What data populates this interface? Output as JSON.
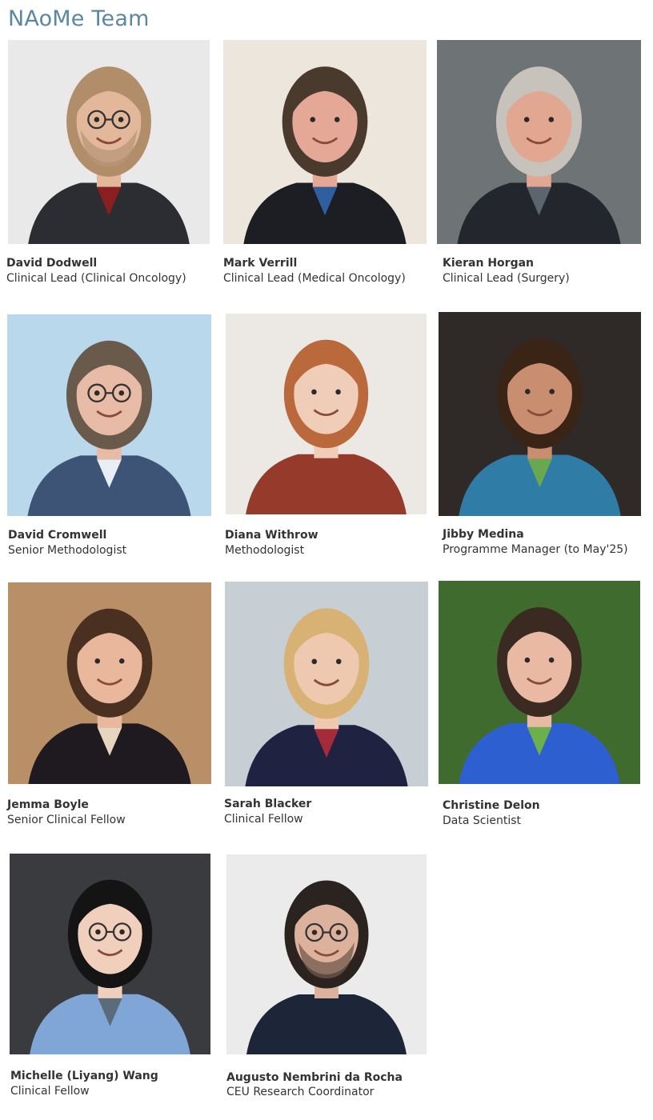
{
  "page": {
    "title": "NAoMe Team"
  },
  "members": [
    {
      "name": "David Dodwell",
      "role": "Clinical Lead (Clinical Oncology)",
      "photo": {
        "bg": "#e9e9e9",
        "skin": "#e2b79a",
        "hair": "#b28d6a",
        "top": "#2b2d33",
        "glasses": true,
        "beard": "#b89677",
        "accent": "#8b1f1f"
      }
    },
    {
      "name": "Mark Verrill",
      "role": "Clinical Lead (Medical Oncology)",
      "photo": {
        "bg": "#ece6dc",
        "skin": "#e6a896",
        "hair": "#4a3a2e",
        "top": "#1c1e24",
        "glasses": false,
        "beard": "",
        "accent": "#2f5f9e"
      }
    },
    {
      "name": "Kieran Horgan",
      "role": "Clinical Lead (Surgery)",
      "photo": {
        "bg": "#6e7475",
        "skin": "#e2a791",
        "hair": "#c7c2bc",
        "top": "#23262d",
        "glasses": false,
        "beard": "",
        "accent": "#5c6470"
      }
    },
    {
      "name": "David Cromwell",
      "role": "Senior Methodologist",
      "photo": {
        "bg": "#b9d8ec",
        "skin": "#e7bba6",
        "hair": "#6a5a4c",
        "top": "#3d5476",
        "glasses": true,
        "beard": "",
        "accent": "#e8eef3"
      }
    },
    {
      "name": "Diana Withrow",
      "role": "Methodologist",
      "photo": {
        "bg": "#ece9e5",
        "skin": "#f0cdb9",
        "hair": "#b9693c",
        "top": "#963a2c",
        "glasses": false,
        "beard": "",
        "accent": "#963a2c"
      }
    },
    {
      "name": "Jibby Medina",
      "role": "Programme Manager (to May'25)",
      "photo": {
        "bg": "#2f2928",
        "skin": "#c98e6f",
        "hair": "#3a2416",
        "top": "#2f7ca6",
        "glasses": false,
        "beard": "",
        "accent": "#6aa84f"
      }
    },
    {
      "name": "Jemma Boyle",
      "role": "Senior Clinical Fellow",
      "photo": {
        "bg": "#b98f68",
        "skin": "#e9b89c",
        "hair": "#4a3020",
        "top": "#1e1a1f",
        "glasses": false,
        "beard": "",
        "accent": "#e6d6bf"
      }
    },
    {
      "name": "Sarah Blacker",
      "role": "Clinical Fellow",
      "photo": {
        "bg": "#c7ced4",
        "skin": "#efc8b0",
        "hair": "#d8b274",
        "top": "#1f2240",
        "glasses": false,
        "beard": "",
        "accent": "#a52a3a"
      }
    },
    {
      "name": "Christine Delon",
      "role": "Data Scientist",
      "photo": {
        "bg": "#3f6b2e",
        "skin": "#e9b9a3",
        "hair": "#3a2a22",
        "top": "#2e5fd1",
        "glasses": false,
        "beard": "",
        "accent": "#6bb04a"
      }
    },
    {
      "name": "Michelle (Liyang) Wang",
      "role": "Clinical Fellow",
      "photo": {
        "bg": "#3a3b3f",
        "skin": "#f1cfbd",
        "hair": "#141414",
        "top": "#7fa6d6",
        "glasses": true,
        "beard": "",
        "accent": "#5a6b7b"
      }
    },
    {
      "name": "Augusto Nembrini da Rocha",
      "role": "CEU Research Coordinator",
      "photo": {
        "bg": "#ebebeb",
        "skin": "#ddb29c",
        "hair": "#2b2320",
        "top": "#1c2638",
        "glasses": true,
        "beard": "#6f5a4d",
        "accent": "#1c2638"
      }
    }
  ]
}
